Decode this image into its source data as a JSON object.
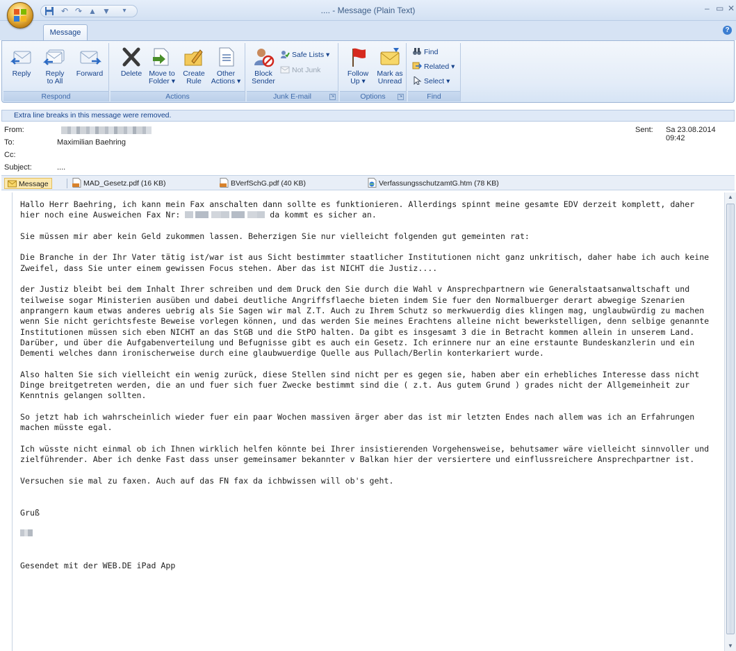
{
  "window": {
    "title": ".... - Message (Plain Text)",
    "tab": "Message"
  },
  "ribbon": {
    "respond": {
      "label": "Respond",
      "reply": "Reply",
      "reply_all": "Reply\nto All",
      "forward": "Forward"
    },
    "actions": {
      "label": "Actions",
      "delete": "Delete",
      "move_to_folder": "Move to\nFolder ▾",
      "create_rule": "Create\nRule",
      "other_actions": "Other\nActions ▾"
    },
    "junk": {
      "label": "Junk E-mail",
      "block_sender": "Block\nSender",
      "safe_lists": "Safe Lists ▾",
      "not_junk": "Not Junk"
    },
    "options": {
      "label": "Options",
      "follow_up": "Follow\nUp ▾",
      "mark_as_unread": "Mark as\nUnread"
    },
    "find": {
      "label": "Find",
      "find": "Find",
      "related": "Related ▾",
      "select": "Select ▾"
    }
  },
  "infobar": "Extra line breaks in this message were removed.",
  "header": {
    "from_label": "From:",
    "to_label": "To:",
    "to_value": "Maximilian Baehring",
    "cc_label": "Cc:",
    "subject_label": "Subject:",
    "subject_value": "....",
    "sent_label": "Sent:",
    "sent_value": "Sa 23.08.2014 09:42"
  },
  "attachments": [
    {
      "name": "Message",
      "icon": "envelope-icon"
    },
    {
      "name": "MAD_Gesetz.pdf (16 KB)",
      "icon": "pdf-icon"
    },
    {
      "name": "BVerfSchG.pdf (40 KB)",
      "icon": "pdf-icon"
    },
    {
      "name": "VerfassungsschutzamtG.htm (78 KB)",
      "icon": "htm-icon"
    }
  ],
  "body": {
    "p1a": "Hallo Herr Baehring, ich kann mein Fax anschalten dann sollte es funktionieren. Allerdings spinnt meine gesamte EDV derzeit komplett, daher hier noch eine Ausweichen Fax Nr: ",
    "p1b": " da kommt es sicher an.",
    "p2": "Sie müssen mir aber kein Geld zukommen lassen. Beherzigen Sie nur vielleicht folgenden gut gemeinten rat:",
    "p3": "Die Branche in der Ihr Vater tätig ist/war ist aus Sicht bestimmter staatlicher Institutionen nicht ganz unkritisch, daher habe ich auch keine Zweifel, dass Sie unter einem gewissen Focus stehen. Aber das ist NICHT die Justiz....",
    "p4": "der Justiz bleibt bei dem Inhalt Ihrer schreiben und dem Druck den Sie durch die Wahl v Ansprechpartnern wie Generalstaatsanwaltschaft und teilweise sogar Ministerien ausüben und dabei deutliche Angriffsflaeche bieten indem Sie fuer den Normalbuerger derart abwegige Szenarien anprangern kaum etwas anderes uebrig als Sie Sagen wir mal Z.T. Auch zu Ihrem Schutz so merkwuerdig dies klingen mag, unglaubwürdig zu machen wenn Sie nicht gerichtsfeste  Beweise vorlegen können, und das werden Sie meines Erachtens alleine nicht bewerkstelligen,  denn selbige genannte Institutionen müssen sich eben NICHT an das StGB und die StPO halten. Da gibt es insgesamt 3 die in Betracht kommen allein in unserem Land. Darüber, und über die Aufgabenverteilung und Befugnisse gibt es auch ein Gesetz. Ich erinnere nur an eine erstaunte Bundeskanzlerin und ein Dementi welches dann ironischerweise durch eine glaubwuerdige Quelle aus Pullach/Berlin konterkariert wurde.",
    "p5": "Also halten Sie sich vielleicht ein wenig zurück, diese Stellen sind nicht per es gegen sie, haben aber ein erhebliches Interesse dass nicht Dinge breitgetreten werden, die an und fuer sich fuer Zwecke bestimmt sind die ( z.t. Aus gutem Grund ) grades nicht der Allgemeinheit zur Kenntnis gelangen sollten.",
    "p6": "So jetzt hab ich wahrscheinlich wieder fuer ein paar Wochen massiven ärger aber das ist mir letzten Endes nach allem was ich an Erfahrungen machen müsste egal.",
    "p7": "Ich wüsste nicht einmal ob ich Ihnen wirklich helfen könnte bei Ihrer insistierenden Vorgehensweise, behutsamer wäre vielleicht sinnvoller und zielführender. Aber ich denke Fast dass unser gemeinsamer bekannter v Balkan hier der versiertere und einflussreichere Ansprechpartner ist.",
    "p8": "Versuchen sie mal zu faxen. Auch auf das FN fax da ichbwissen will ob's geht.",
    "greeting": "Gruß",
    "footer": "Gesendet mit der WEB.DE iPad App"
  },
  "colors": {
    "ribbon_text": "#15428b",
    "title_text": "#3d5d87",
    "group_label": "#3e6aaa",
    "selected_attachment": "#fbe9b0"
  }
}
